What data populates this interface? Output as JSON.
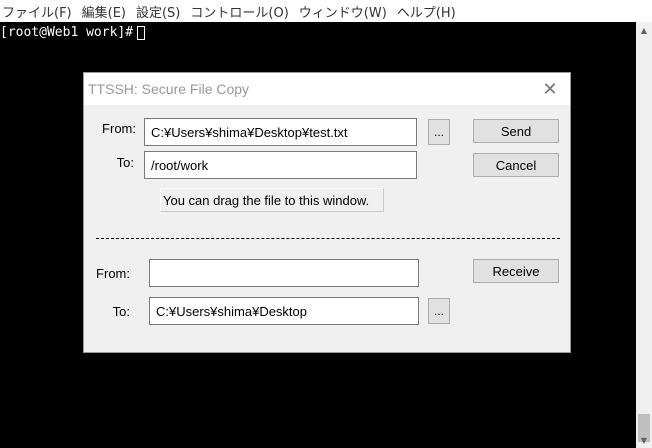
{
  "menu": {
    "items": [
      "ファイル(F)",
      "編集(E)",
      "設定(S)",
      "コントロール(O)",
      "ウィンドウ(W)",
      "ヘルプ(H)"
    ]
  },
  "terminal": {
    "prompt": "[root@Web1 work]#"
  },
  "dialog": {
    "title": "TTSSH: Secure File Copy",
    "send_section": {
      "from_label": "From:",
      "from_value": "C:¥Users¥shima¥Desktop¥test.txt",
      "browse_label": "...",
      "to_label": "To:",
      "to_value": "/root/work",
      "hint": "You can drag the file to this window.",
      "send_button": "Send",
      "cancel_button": "Cancel"
    },
    "receive_section": {
      "from_label": "From:",
      "from_value": "",
      "to_label": "To:",
      "to_value": "C:¥Users¥shima¥Desktop",
      "browse_label": "...",
      "receive_button": "Receive"
    }
  },
  "icons": {
    "close": "close-icon",
    "scroll_up": "scroll-up-arrow-icon",
    "scroll_down": "scroll-down-arrow-icon"
  }
}
